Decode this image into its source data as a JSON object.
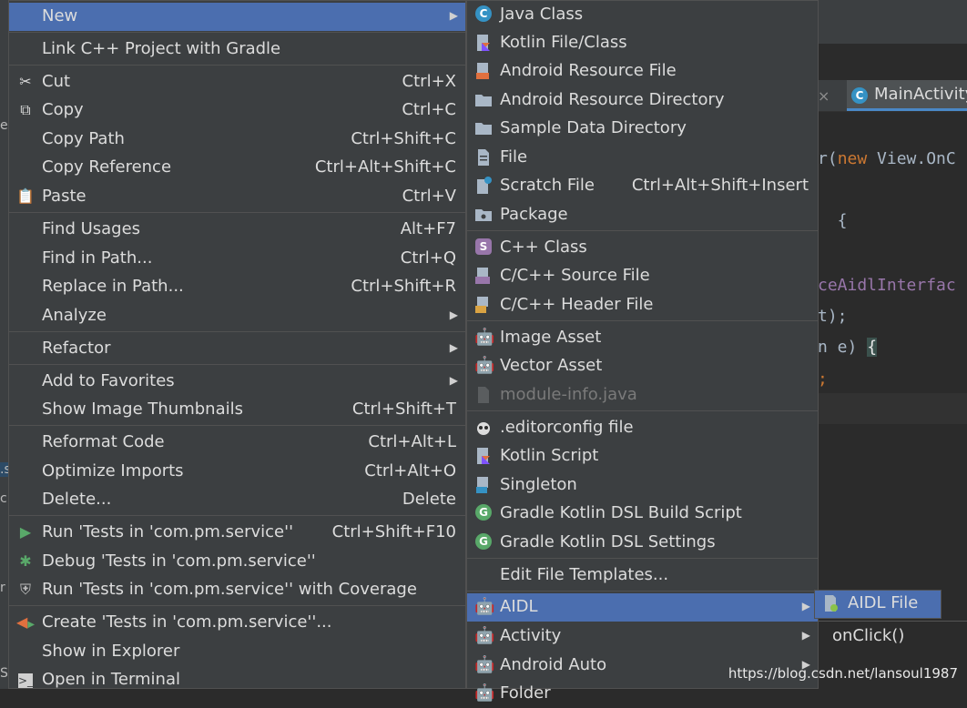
{
  "editor": {
    "tab_label": "MainActivity",
    "tab_close": "×",
    "code_line1_a": "r(",
    "code_line1_kw": "new",
    "code_line1_b": " View.OnC",
    "code_line2": "  {",
    "code_line3": "ceAidlInterfac",
    "code_line4": "t);",
    "code_line5_a": "n e) ",
    "code_line5_b": "{",
    "code_line6": ";",
    "popup_item": "onClick()"
  },
  "left_marks": [
    "e",
    ".s",
    "c",
    "r",
    "S"
  ],
  "watermark": "https://blog.csdn.net/lansoul1987",
  "main_menu": {
    "new": "New",
    "link_cpp": "Link C++ Project with Gradle",
    "cut": "Cut",
    "cut_sc": "Ctrl+X",
    "copy": "Copy",
    "copy_sc": "Ctrl+C",
    "copy_path": "Copy Path",
    "copy_path_sc": "Ctrl+Shift+C",
    "copy_ref": "Copy Reference",
    "copy_ref_sc": "Ctrl+Alt+Shift+C",
    "paste": "Paste",
    "paste_sc": "Ctrl+V",
    "find_usages": "Find Usages",
    "find_usages_sc": "Alt+F7",
    "find_in_path": "Find in Path...",
    "find_in_path_sc": "Ctrl+Q",
    "replace_in_path": "Replace in Path...",
    "replace_in_path_sc": "Ctrl+Shift+R",
    "analyze": "Analyze",
    "refactor": "Refactor",
    "add_favorites": "Add to Favorites",
    "show_thumbs": "Show Image Thumbnails",
    "show_thumbs_sc": "Ctrl+Shift+T",
    "reformat": "Reformat Code",
    "reformat_sc": "Ctrl+Alt+L",
    "optimize": "Optimize Imports",
    "optimize_sc": "Ctrl+Alt+O",
    "delete": "Delete...",
    "delete_sc": "Delete",
    "run_tests": "Run 'Tests in 'com.pm.service''",
    "run_tests_sc": "Ctrl+Shift+F10",
    "debug_tests": "Debug 'Tests in 'com.pm.service''",
    "run_coverage": "Run 'Tests in 'com.pm.service'' with Coverage",
    "create_tests": "Create 'Tests in 'com.pm.service''...",
    "show_explorer": "Show in Explorer",
    "open_terminal": "Open in Terminal"
  },
  "new_menu": {
    "java_class": "Java Class",
    "kotlin_file": "Kotlin File/Class",
    "android_res_file": "Android Resource File",
    "android_res_dir": "Android Resource Directory",
    "sample_data": "Sample Data Directory",
    "file": "File",
    "scratch": "Scratch File",
    "scratch_sc": "Ctrl+Alt+Shift+Insert",
    "package": "Package",
    "cpp_class": "C++ Class",
    "cpp_source": "C/C++ Source File",
    "cpp_header": "C/C++ Header File",
    "image_asset": "Image Asset",
    "vector_asset": "Vector Asset",
    "module_info": "module-info.java",
    "editorconfig": ".editorconfig file",
    "kotlin_script": "Kotlin Script",
    "singleton": "Singleton",
    "gradle_build": "Gradle Kotlin DSL Build Script",
    "gradle_settings": "Gradle Kotlin DSL Settings",
    "edit_templates": "Edit File Templates...",
    "aidl": "AIDL",
    "activity": "Activity",
    "android_auto": "Android Auto",
    "folder": "Folder"
  },
  "aidl_menu": {
    "aidl_file": "AIDL File"
  },
  "colors": {
    "menu_bg": "#3c3f41",
    "selection": "#4b6eaf",
    "android_green": "#8bc34a",
    "class_blue": "#3592c4"
  }
}
